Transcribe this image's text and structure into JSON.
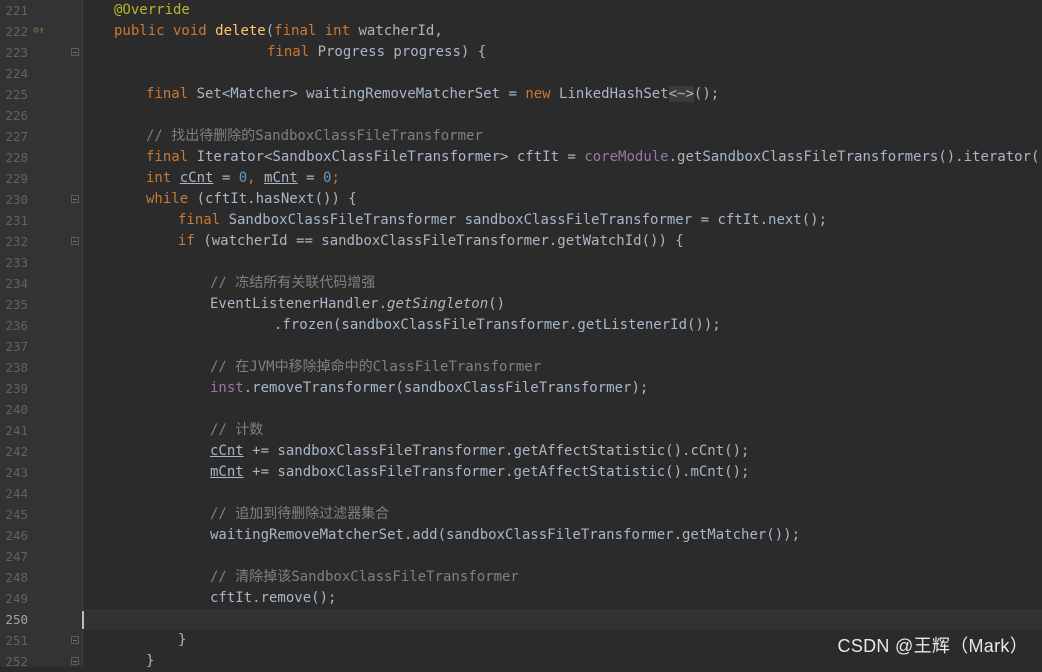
{
  "colors": {
    "background": "#2b2b2b",
    "gutter": "#313335",
    "keyword": "#cc7832",
    "annotation": "#bbb529",
    "number": "#6897bb",
    "comment": "#808080",
    "field": "#9876aa",
    "method_decl": "#ffc66d",
    "text": "#a9b7c6"
  },
  "gutter": {
    "current_line": "250",
    "line_numbers": [
      "221",
      "222",
      "223",
      "224",
      "225",
      "226",
      "227",
      "228",
      "229",
      "230",
      "231",
      "232",
      "233",
      "234",
      "235",
      "236",
      "237",
      "238",
      "239",
      "240",
      "241",
      "242",
      "243",
      "244",
      "245",
      "246",
      "247",
      "248",
      "249",
      "250",
      "251",
      "252"
    ],
    "override_marker_icon": "override-method-icon"
  },
  "code": {
    "l221": "@Override",
    "l222_a": "public void ",
    "l222_fn": "delete",
    "l222_b": "(",
    "l222_kw": "final int ",
    "l222_c": "watcherId,",
    "l223_kw": "final ",
    "l223_a": "Progress progress) {",
    "l225_kw": "final ",
    "l225_a": "Set<Matcher> waitingRemoveMatcherSet = ",
    "l225_new": "new ",
    "l225_b": "LinkedHashSet",
    "l225_d": "<~>",
    "l225_c": "();",
    "l227": "// 找出待删除的SandboxClassFileTransformer",
    "l228_kw": "final ",
    "l228_a": "Iterator<SandboxClassFileTransformer> cftIt = ",
    "l228_fld": "coreModule",
    "l228_b": ".getSandboxClassFileTransformers().iterator();",
    "l229_kw": "int ",
    "l229_v1": "cCnt",
    "l229_a": " = ",
    "l229_n1": "0",
    "l229_b": ", ",
    "l229_v2": "mCnt",
    "l229_c": " = ",
    "l229_n2": "0",
    "l229_d": ";",
    "l230_kw": "while ",
    "l230_a": "(cftIt.hasNext()) {",
    "l231_kw": "final ",
    "l231_a": "SandboxClassFileTransformer sandboxClassFileTransformer = cftIt.next();",
    "l232_kw": "if ",
    "l232_a": "(watcherId == sandboxClassFileTransformer.getWatchId()) {",
    "l234": "// 冻结所有关联代码增强",
    "l235_a": "EventListenerHandler.",
    "l235_i": "getSingleton",
    "l235_b": "()",
    "l236": ".frozen(sandboxClassFileTransformer.getListenerId());",
    "l238": "// 在JVM中移除掉命中的ClassFileTransformer",
    "l239_fld": "inst",
    "l239_a": ".removeTransformer(sandboxClassFileTransformer);",
    "l241": "// 计数",
    "l242_v": "cCnt",
    "l242_a": " += sandboxClassFileTransformer.getAffectStatistic().cCnt();",
    "l243_v": "mCnt",
    "l243_a": " += sandboxClassFileTransformer.getAffectStatistic().mCnt();",
    "l245": "// 追加到待删除过滤器集合",
    "l246": "waitingRemoveMatcherSet.add(sandboxClassFileTransformer.getMatcher());",
    "l248": "// 清除掉该SandboxClassFileTransformer",
    "l249": "cftIt.remove();",
    "l251": "}",
    "l252": "}"
  },
  "watermark": "CSDN @王辉（Mark）"
}
